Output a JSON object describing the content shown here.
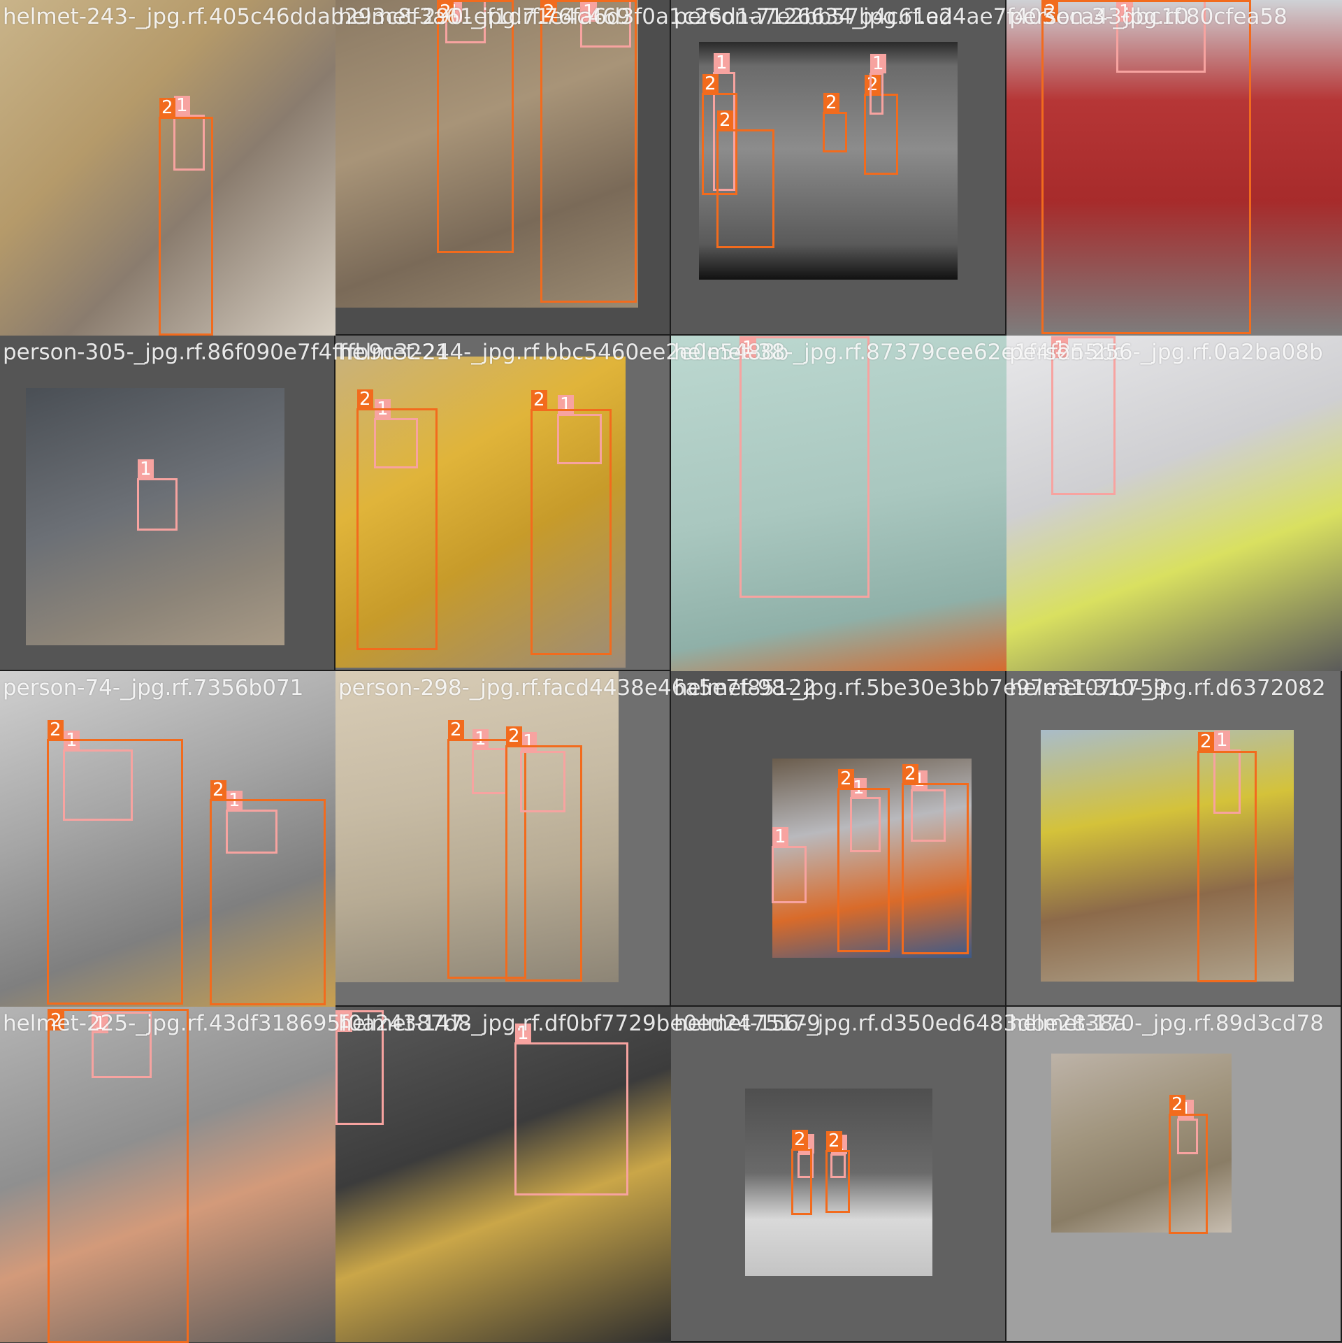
{
  "colors": {
    "class_1": "#f7a3a0",
    "class_2": "#f26b1d",
    "tile_letterbox_dark": "#4a4a4a",
    "tile_letterbox_mid": "#6e6e6e",
    "tile_letterbox_light": "#9a9a9a"
  },
  "tiles": [
    {
      "label": "helmet-243-_jpg.rf.405c46ddab293c8f3a61ef1d71e4c469"
    },
    {
      "label": "helmet-290-_jpg.rf.76fa6d3f0a1c26d1a7e2bb57b4c61a2"
    },
    {
      "label": "person-7126634_jpg.rf.ed4ae7f405eca43dbc10"
    },
    {
      "label": "person-3-_jpg.rf.80cfea58"
    },
    {
      "label": "person-305-_jpg.rf.86f090e7f4fffb9c3224"
    },
    {
      "label": "helmet-214-_jpg.rf.bbc5460ee2e0e5488b"
    },
    {
      "label": "helmet-38-_jpg.rf.87379cee62e1f4f255bc"
    },
    {
      "label": "person-256-_jpg.rf.0a2ba08b"
    },
    {
      "label": "person-74-_jpg.rf.7356b071"
    },
    {
      "label": "person-298-_jpg.rf.facd4438e46a5e7f85122"
    },
    {
      "label": "helmet-98-_jpg.rf.5be30e3bb7e97e3107b759"
    },
    {
      "label": "helmet-310-_jpg.rf.d6372082"
    },
    {
      "label": "helmet-225-_jpg.rf.43df318695f0a24387d8"
    },
    {
      "label": "helmet-147-_jpg.rf.df0bf7729be0ed2475179"
    },
    {
      "label": "helmet-156-_jpg.rf.d350ed6483dbe2838a"
    },
    {
      "label": "helmet-170-_jpg.rf.89d3cd78"
    }
  ],
  "box_tags": {
    "class_1": "1",
    "class_2": "2"
  }
}
